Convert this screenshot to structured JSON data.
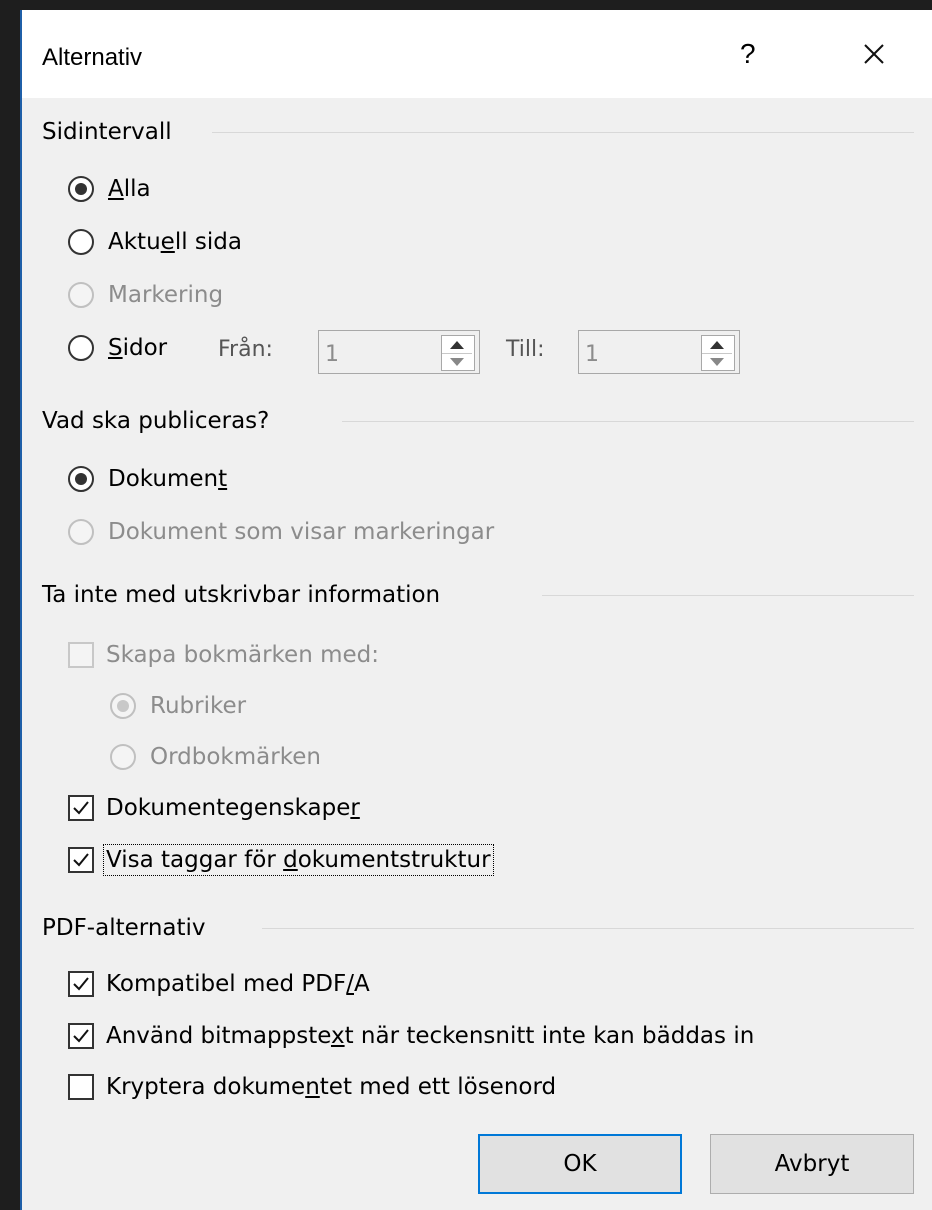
{
  "dialog": {
    "title": "Alternativ",
    "help_label": "?"
  },
  "sections": {
    "page_range": "Sidintervall",
    "publish": "Vad ska publiceras?",
    "non_print": "Ta inte med utskrivbar information",
    "pdf": "PDF-alternativ"
  },
  "page_range": {
    "all_label": "lla",
    "all_key": "A",
    "current_pre": "Aktu",
    "current_key": "e",
    "current_post": "ll sida",
    "selection_label": "Markering",
    "pages_key": "S",
    "pages_post": "idor",
    "from_label": "Från:",
    "from_value": "1",
    "to_label": "Till:",
    "to_value": "1"
  },
  "publish": {
    "document_pre": "Dokumen",
    "document_key": "t",
    "markup_label": "Dokument som visar markeringar"
  },
  "non_print": {
    "bookmarks_label": "Skapa bokmärken med:",
    "headings_label": "Rubriker",
    "word_bookmarks_label": "Ordbokmärken",
    "props_pre": "Dokumentegenskape",
    "props_key": "r",
    "tags_pre": "Visa taggar för ",
    "tags_key": "d",
    "tags_post": "okumentstruktur"
  },
  "pdf": {
    "pdfa_pre": "Kompatibel med PDF",
    "pdfa_key": "/",
    "pdfa_post": "A",
    "bitmap_pre": "Använd bitmappste",
    "bitmap_key": "x",
    "bitmap_post": "t när teckensnitt inte kan bäddas in",
    "encrypt_pre": "Kryptera dokume",
    "encrypt_key": "n",
    "encrypt_post": "tet med ett lösenord"
  },
  "buttons": {
    "ok": "OK",
    "cancel": "Avbryt"
  },
  "colors": {
    "accent": "#0078d7",
    "border": "#1f5fa8"
  }
}
